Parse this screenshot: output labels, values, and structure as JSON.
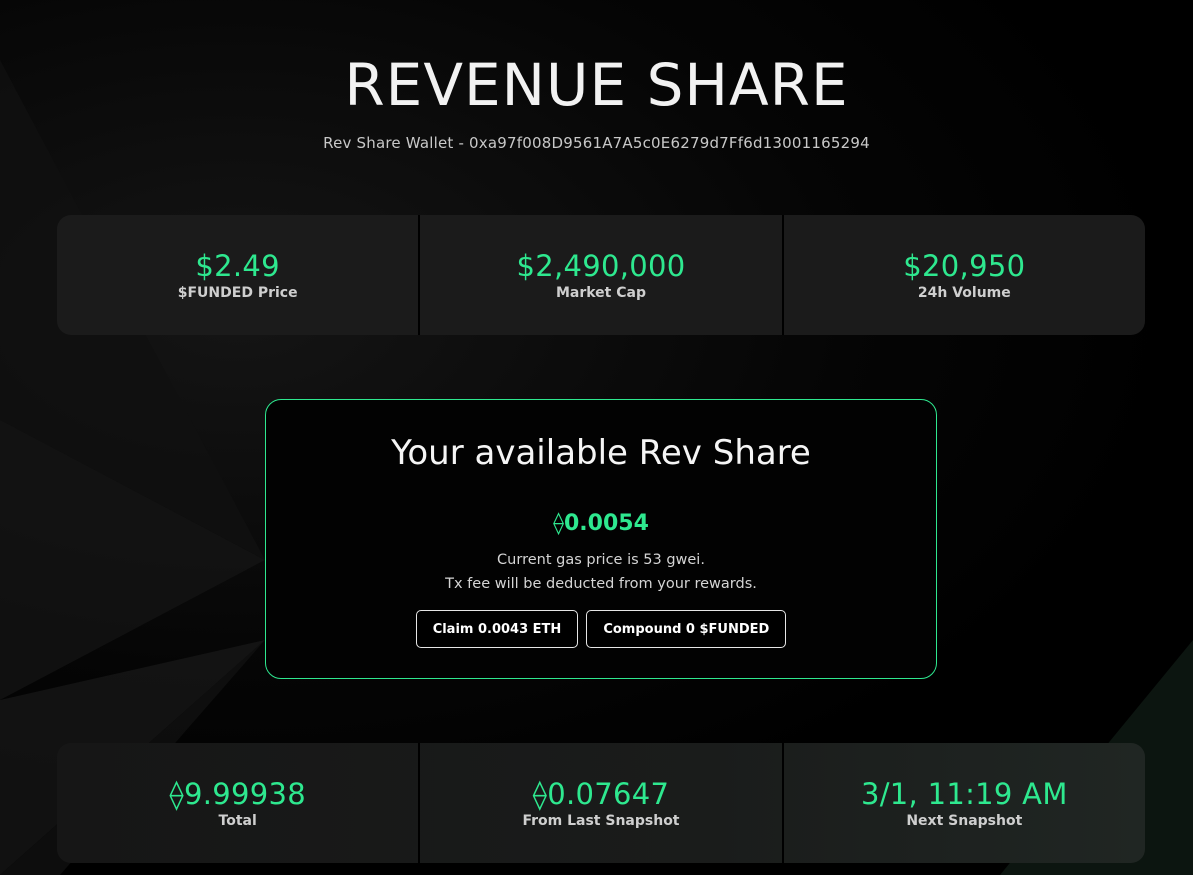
{
  "header": {
    "title": "REVENUE SHARE",
    "wallet_label": "Rev Share Wallet - 0xa97f008D9561A7A5c0E6279d7Ff6d13001165294"
  },
  "token_stats": [
    {
      "value": "$2.49",
      "label": "$FUNDED Price"
    },
    {
      "value": "$2,490,000",
      "label": "Market Cap"
    },
    {
      "value": "$20,950",
      "label": "24h Volume"
    }
  ],
  "rev_share_card": {
    "title": "Your available Rev Share",
    "amount": "⟠0.0054",
    "gas_note": "Current gas price is 53 gwei.",
    "fee_note": "Tx fee will be deducted from your rewards.",
    "claim_label": "Claim 0.0043 ETH",
    "compound_label": "Compound 0 $FUNDED"
  },
  "pool_stats": [
    {
      "value": "⟠9.99938",
      "label": "Total"
    },
    {
      "value": "⟠0.07647",
      "label": "From Last Snapshot"
    },
    {
      "value": "3/1, 11:19 AM",
      "label": "Next Snapshot"
    }
  ],
  "colors": {
    "accent": "#2ee88f",
    "panel": "#1b1b1b",
    "background": "#000000"
  }
}
